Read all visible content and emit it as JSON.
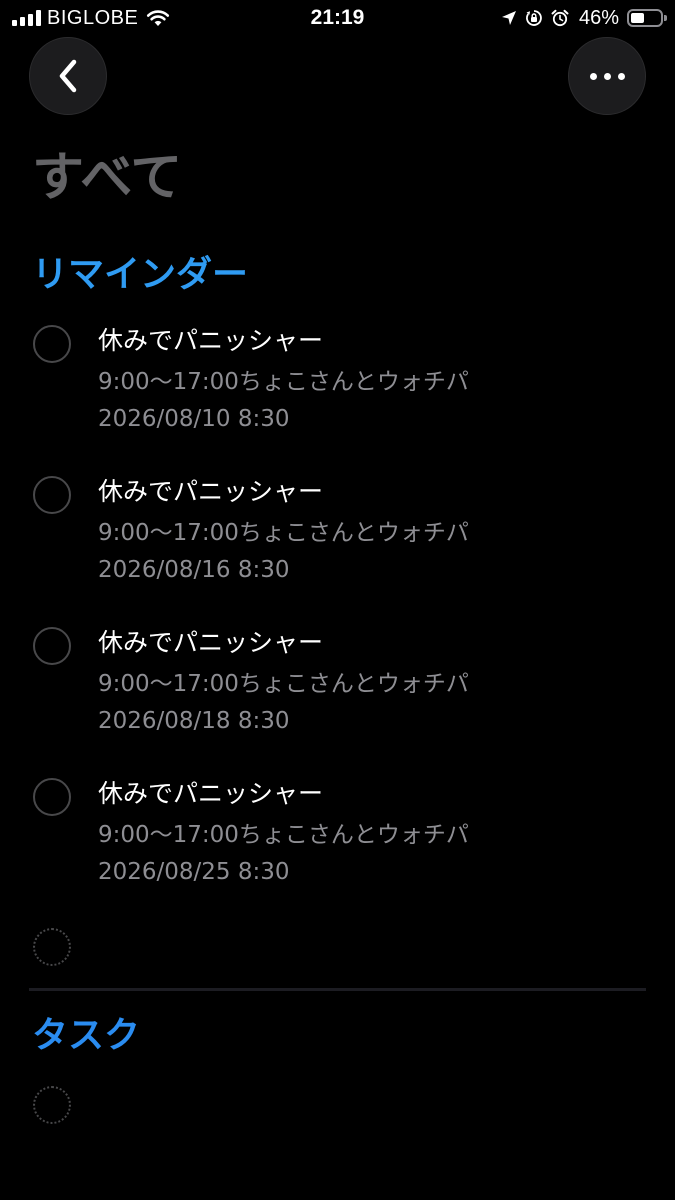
{
  "status_bar": {
    "carrier": "BIGLOBE",
    "time": "21:19",
    "battery_percent": "46%",
    "battery_level": 0.46,
    "icons": [
      "signal-icon",
      "wifi-icon",
      "location-icon",
      "orientation-lock-icon",
      "alarm-icon",
      "battery-icon"
    ]
  },
  "nav": {
    "back_icon": "chevron-left-icon",
    "more_icon": "ellipsis-icon"
  },
  "page": {
    "title": "すべて"
  },
  "reminders": {
    "header": "リマインダー",
    "items": [
      {
        "title": "休みでパニッシャー",
        "note": "9:00〜17:00ちょこさんとウォチパ",
        "date": "2026/08/10 8:30"
      },
      {
        "title": "休みでパニッシャー",
        "note": "9:00〜17:00ちょこさんとウォチパ",
        "date": "2026/08/16 8:30"
      },
      {
        "title": "休みでパニッシャー",
        "note": "9:00〜17:00ちょこさんとウォチパ",
        "date": "2026/08/18 8:30"
      },
      {
        "title": "休みでパニッシャー",
        "note": "9:00〜17:00ちょこさんとウォチパ",
        "date": "2026/08/25 8:30"
      }
    ]
  },
  "tasks": {
    "header": "タスク"
  },
  "colors": {
    "background": "#000000",
    "accent_blue": "#2f9bf2",
    "secondary_text": "#8e8e93",
    "title_gray": "#636366"
  }
}
